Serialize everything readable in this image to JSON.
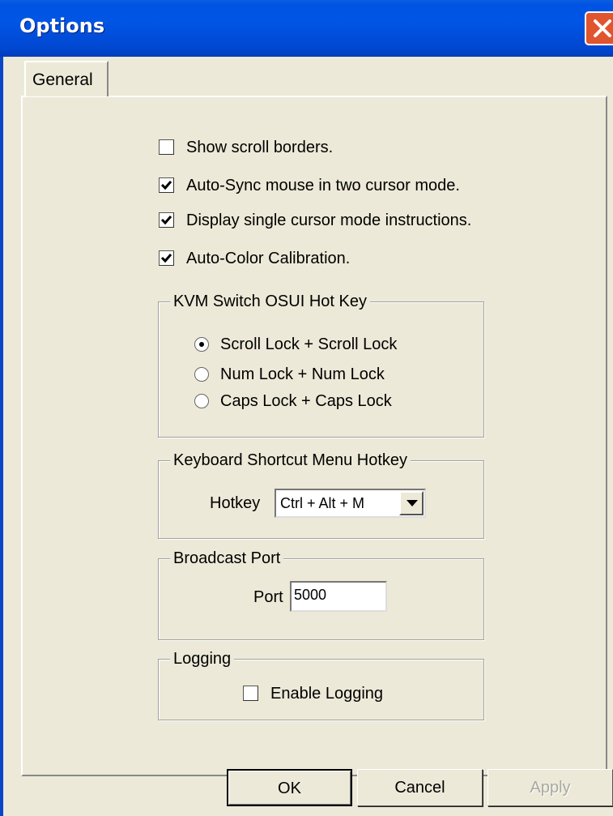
{
  "window": {
    "title": "Options"
  },
  "tabs": [
    {
      "label": "General",
      "selected": true
    }
  ],
  "general": {
    "checkboxes": [
      {
        "label": "Show scroll borders.",
        "checked": false
      },
      {
        "label": "Auto-Sync mouse in two cursor mode.",
        "checked": true
      },
      {
        "label": "Display single cursor mode instructions.",
        "checked": true
      },
      {
        "label": "Auto-Color Calibration.",
        "checked": true
      }
    ],
    "kvm_group": {
      "title": "KVM Switch OSUI Hot Key",
      "options": [
        {
          "label": "Scroll Lock + Scroll Lock",
          "selected": true
        },
        {
          "label": "Num Lock + Num Lock",
          "selected": false
        },
        {
          "label": "Caps Lock + Caps Lock",
          "selected": false
        }
      ]
    },
    "shortcut_group": {
      "title": "Keyboard Shortcut Menu Hotkey",
      "hotkey_label": "Hotkey",
      "hotkey_value": "Ctrl + Alt + M"
    },
    "broadcast_group": {
      "title": "Broadcast Port",
      "port_label": "Port",
      "port_value": "5000"
    },
    "logging_group": {
      "title": "Logging",
      "enable_label": "Enable Logging",
      "enable_checked": false
    }
  },
  "buttons": {
    "ok": "OK",
    "cancel": "Cancel",
    "apply": "Apply"
  }
}
